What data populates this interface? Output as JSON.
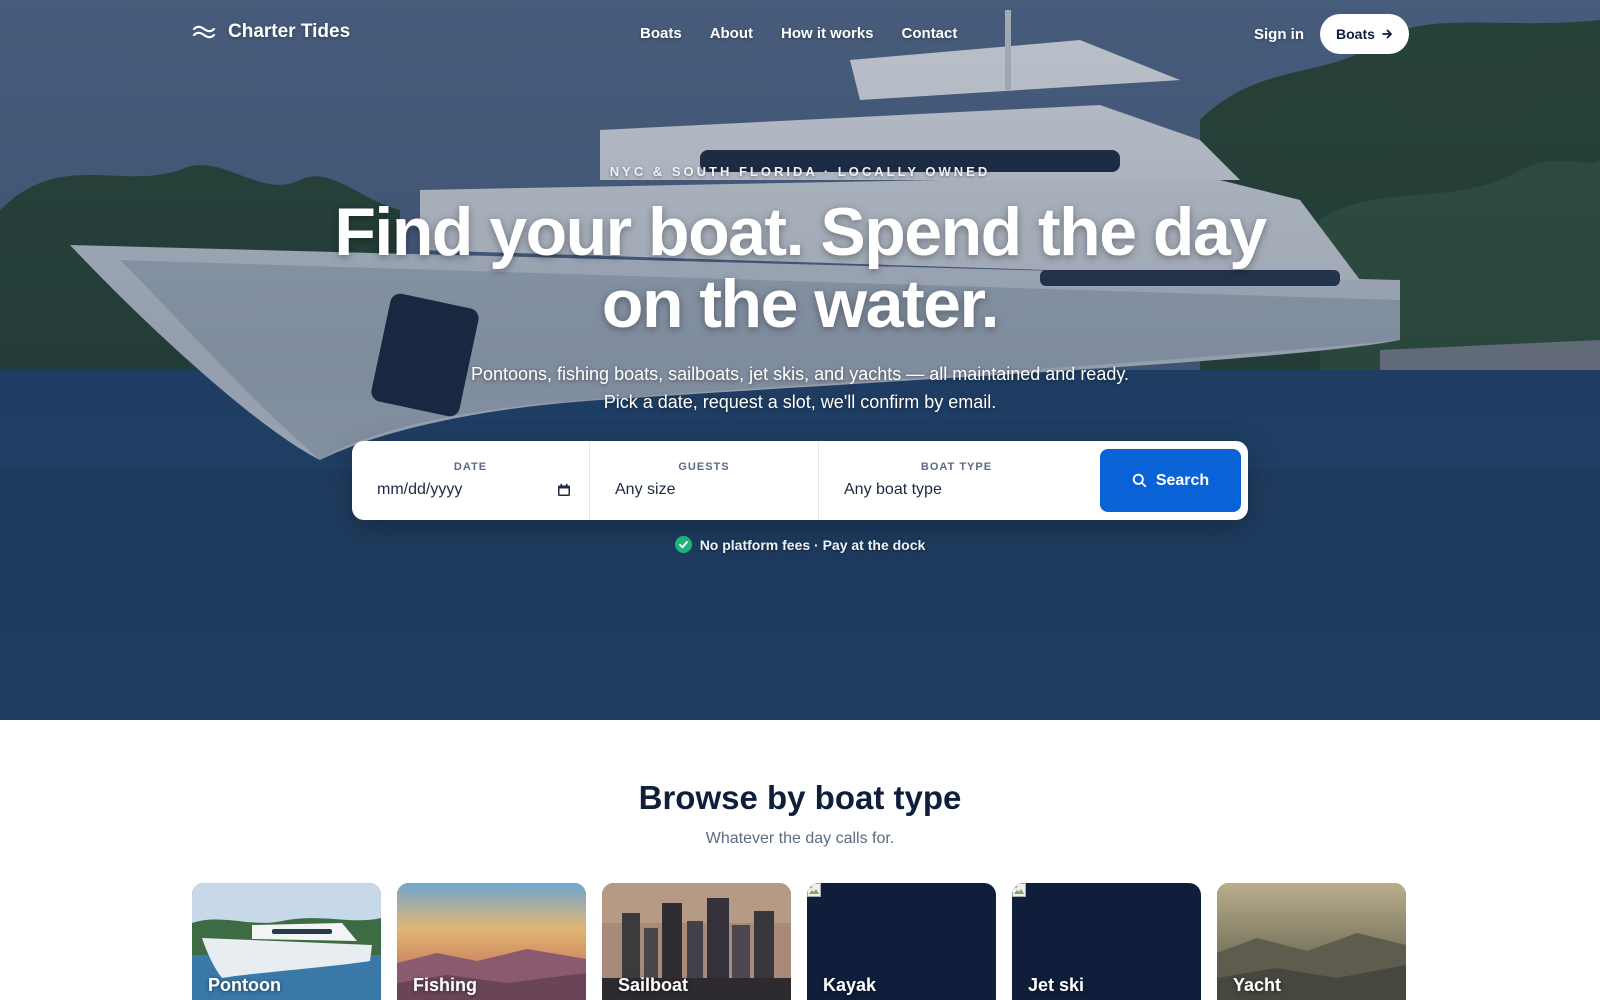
{
  "nav": {
    "brand": "Charter Tides",
    "links": [
      "Boats",
      "About",
      "How it works",
      "Contact"
    ],
    "signin": "Sign in",
    "cta": "Boats"
  },
  "hero": {
    "eyebrow": "NYC & SOUTH FLORIDA · LOCALLY OWNED",
    "headline": "Find your boat. Spend the day on the water.",
    "subhead_line1": "Pontoons, fishing boats, sailboats, jet skis, and yachts — all maintained and ready.",
    "subhead_line2": "Pick a date, request a slot, we'll confirm by email."
  },
  "search": {
    "date_label": "DATE",
    "date_value": "mm/dd/yyyy",
    "guests_label": "GUESTS",
    "guests_value": "Any size",
    "type_label": "BOAT TYPE",
    "type_value": "Any boat type",
    "button": "Search",
    "accent": "#0a63d6"
  },
  "trust": {
    "text": "No platform fees · Pay at the dock",
    "icon": "check-circle-icon",
    "color": "#22b07d"
  },
  "browse": {
    "title": "Browse by boat type",
    "subtitle": "Whatever the day calls for.",
    "cards": [
      {
        "label": "Pontoon"
      },
      {
        "label": "Fishing"
      },
      {
        "label": "Sailboat"
      },
      {
        "label": "Kayak"
      },
      {
        "label": "Jet ski"
      },
      {
        "label": "Yacht"
      }
    ]
  }
}
